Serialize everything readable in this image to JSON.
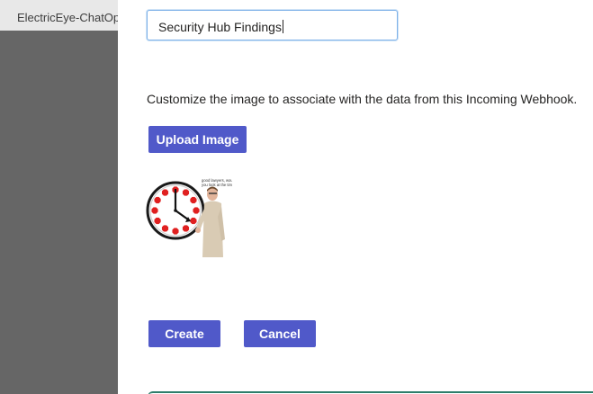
{
  "background_app": {
    "tab_title": "ElectricEye-ChatOp"
  },
  "dialog": {
    "name_input": {
      "value": "Security Hub Findings"
    },
    "description": "Customize the image to associate with the data from this Incoming Webhook.",
    "upload_button": "Upload Image",
    "meme_caption": "good lawyers, would you look at the time!",
    "create_button": "Create",
    "cancel_button": "Cancel"
  },
  "colors": {
    "accent": "#5059c9",
    "input_focus_border": "#7fb2e8",
    "overlay": "#666666",
    "stop_sign_red": "#e02020"
  },
  "icons": {
    "preview": "clock-meme-image"
  }
}
